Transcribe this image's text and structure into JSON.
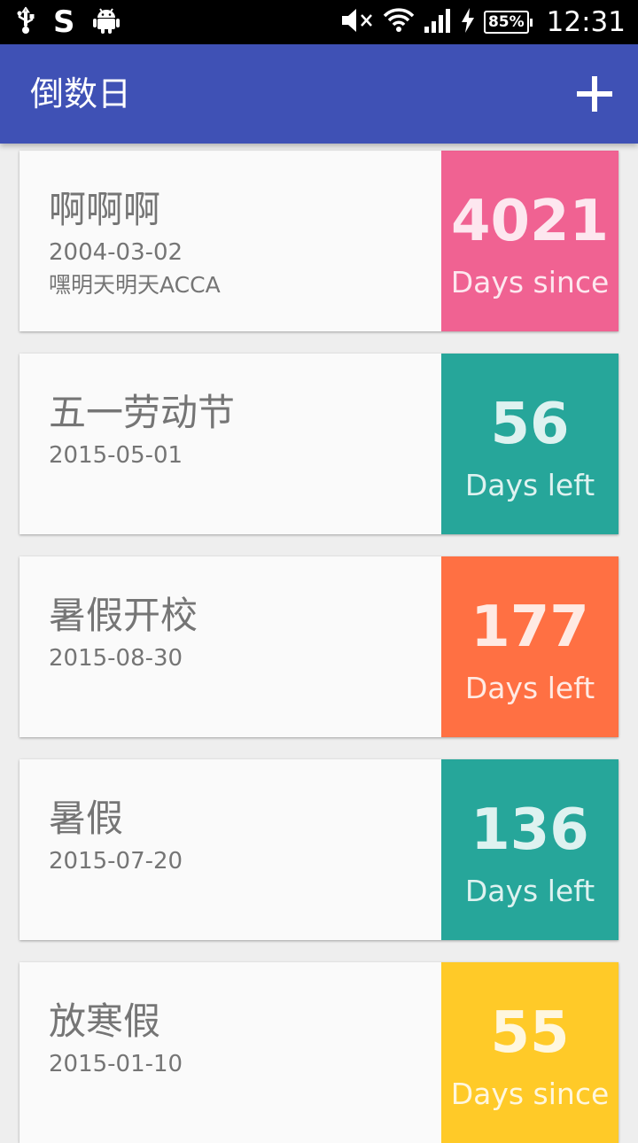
{
  "status_bar": {
    "time": "12:31",
    "battery": "85%",
    "icons": [
      "usb-icon",
      "s-app-icon",
      "android-icon",
      "mute-icon",
      "wifi-icon",
      "signal-icon",
      "charging-icon",
      "battery-icon"
    ]
  },
  "app_bar": {
    "title": "倒数日",
    "add_icon": "plus-icon",
    "color": "#3f51b5"
  },
  "cards": [
    {
      "title": "啊啊啊",
      "date": "2004-03-02",
      "note": "嘿明天明天ACCA",
      "count": "4021",
      "label": "Days since",
      "color": "#f06292"
    },
    {
      "title": "五一劳动节",
      "date": "2015-05-01",
      "note": "",
      "count": "56",
      "label": "Days left",
      "color": "#26a69a"
    },
    {
      "title": "暑假开校",
      "date": "2015-08-30",
      "note": "",
      "count": "177",
      "label": "Days left",
      "color": "#ff7043"
    },
    {
      "title": "暑假",
      "date": "2015-07-20",
      "note": "",
      "count": "136",
      "label": "Days left",
      "color": "#26a69a"
    },
    {
      "title": "放寒假",
      "date": "2015-01-10",
      "note": "",
      "count": "55",
      "label": "Days since",
      "color": "#ffca28"
    }
  ]
}
